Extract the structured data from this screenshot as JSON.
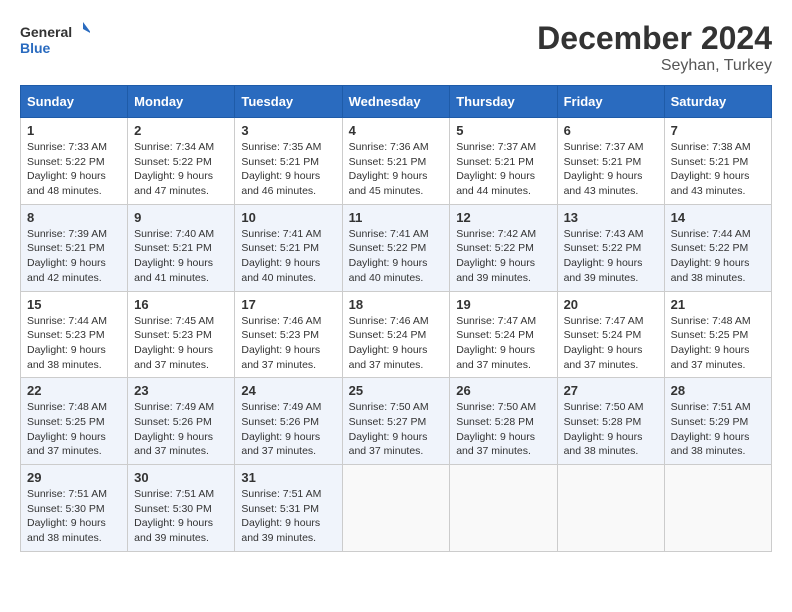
{
  "header": {
    "logo_line1": "General",
    "logo_line2": "Blue",
    "month_year": "December 2024",
    "location": "Seyhan, Turkey"
  },
  "columns": [
    "Sunday",
    "Monday",
    "Tuesday",
    "Wednesday",
    "Thursday",
    "Friday",
    "Saturday"
  ],
  "weeks": [
    [
      {
        "day": "1",
        "sunrise": "7:33 AM",
        "sunset": "5:22 PM",
        "daylight": "9 hours and 48 minutes."
      },
      {
        "day": "2",
        "sunrise": "7:34 AM",
        "sunset": "5:22 PM",
        "daylight": "9 hours and 47 minutes."
      },
      {
        "day": "3",
        "sunrise": "7:35 AM",
        "sunset": "5:21 PM",
        "daylight": "9 hours and 46 minutes."
      },
      {
        "day": "4",
        "sunrise": "7:36 AM",
        "sunset": "5:21 PM",
        "daylight": "9 hours and 45 minutes."
      },
      {
        "day": "5",
        "sunrise": "7:37 AM",
        "sunset": "5:21 PM",
        "daylight": "9 hours and 44 minutes."
      },
      {
        "day": "6",
        "sunrise": "7:37 AM",
        "sunset": "5:21 PM",
        "daylight": "9 hours and 43 minutes."
      },
      {
        "day": "7",
        "sunrise": "7:38 AM",
        "sunset": "5:21 PM",
        "daylight": "9 hours and 43 minutes."
      }
    ],
    [
      {
        "day": "8",
        "sunrise": "7:39 AM",
        "sunset": "5:21 PM",
        "daylight": "9 hours and 42 minutes."
      },
      {
        "day": "9",
        "sunrise": "7:40 AM",
        "sunset": "5:21 PM",
        "daylight": "9 hours and 41 minutes."
      },
      {
        "day": "10",
        "sunrise": "7:41 AM",
        "sunset": "5:21 PM",
        "daylight": "9 hours and 40 minutes."
      },
      {
        "day": "11",
        "sunrise": "7:41 AM",
        "sunset": "5:22 PM",
        "daylight": "9 hours and 40 minutes."
      },
      {
        "day": "12",
        "sunrise": "7:42 AM",
        "sunset": "5:22 PM",
        "daylight": "9 hours and 39 minutes."
      },
      {
        "day": "13",
        "sunrise": "7:43 AM",
        "sunset": "5:22 PM",
        "daylight": "9 hours and 39 minutes."
      },
      {
        "day": "14",
        "sunrise": "7:44 AM",
        "sunset": "5:22 PM",
        "daylight": "9 hours and 38 minutes."
      }
    ],
    [
      {
        "day": "15",
        "sunrise": "7:44 AM",
        "sunset": "5:23 PM",
        "daylight": "9 hours and 38 minutes."
      },
      {
        "day": "16",
        "sunrise": "7:45 AM",
        "sunset": "5:23 PM",
        "daylight": "9 hours and 37 minutes."
      },
      {
        "day": "17",
        "sunrise": "7:46 AM",
        "sunset": "5:23 PM",
        "daylight": "9 hours and 37 minutes."
      },
      {
        "day": "18",
        "sunrise": "7:46 AM",
        "sunset": "5:24 PM",
        "daylight": "9 hours and 37 minutes."
      },
      {
        "day": "19",
        "sunrise": "7:47 AM",
        "sunset": "5:24 PM",
        "daylight": "9 hours and 37 minutes."
      },
      {
        "day": "20",
        "sunrise": "7:47 AM",
        "sunset": "5:24 PM",
        "daylight": "9 hours and 37 minutes."
      },
      {
        "day": "21",
        "sunrise": "7:48 AM",
        "sunset": "5:25 PM",
        "daylight": "9 hours and 37 minutes."
      }
    ],
    [
      {
        "day": "22",
        "sunrise": "7:48 AM",
        "sunset": "5:25 PM",
        "daylight": "9 hours and 37 minutes."
      },
      {
        "day": "23",
        "sunrise": "7:49 AM",
        "sunset": "5:26 PM",
        "daylight": "9 hours and 37 minutes."
      },
      {
        "day": "24",
        "sunrise": "7:49 AM",
        "sunset": "5:26 PM",
        "daylight": "9 hours and 37 minutes."
      },
      {
        "day": "25",
        "sunrise": "7:50 AM",
        "sunset": "5:27 PM",
        "daylight": "9 hours and 37 minutes."
      },
      {
        "day": "26",
        "sunrise": "7:50 AM",
        "sunset": "5:28 PM",
        "daylight": "9 hours and 37 minutes."
      },
      {
        "day": "27",
        "sunrise": "7:50 AM",
        "sunset": "5:28 PM",
        "daylight": "9 hours and 38 minutes."
      },
      {
        "day": "28",
        "sunrise": "7:51 AM",
        "sunset": "5:29 PM",
        "daylight": "9 hours and 38 minutes."
      }
    ],
    [
      {
        "day": "29",
        "sunrise": "7:51 AM",
        "sunset": "5:30 PM",
        "daylight": "9 hours and 38 minutes."
      },
      {
        "day": "30",
        "sunrise": "7:51 AM",
        "sunset": "5:30 PM",
        "daylight": "9 hours and 39 minutes."
      },
      {
        "day": "31",
        "sunrise": "7:51 AM",
        "sunset": "5:31 PM",
        "daylight": "9 hours and 39 minutes."
      },
      null,
      null,
      null,
      null
    ]
  ]
}
